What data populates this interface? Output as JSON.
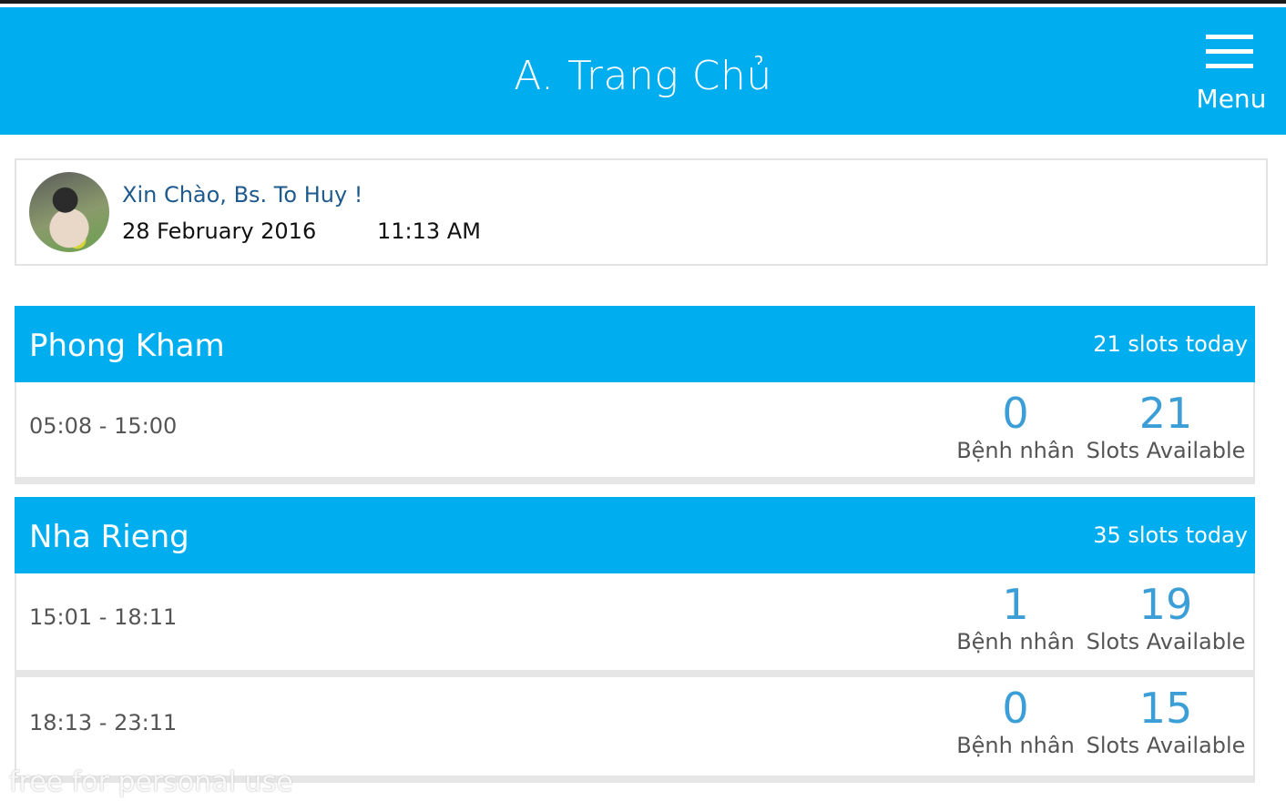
{
  "header": {
    "title": "A. Trang Chủ",
    "menu_label": "Menu"
  },
  "greeting": {
    "name": "Xin Chào, Bs. To Huy !",
    "date": "28 February 2016",
    "time": "11:13 AM"
  },
  "clinics": [
    {
      "name": "Phong Kham",
      "slots_today": "21 slots today",
      "sessions": [
        {
          "time": "05:08 - 15:00",
          "patients": "0",
          "patients_label": "Bệnh nhân",
          "available": "21",
          "available_label": "Slots Available"
        }
      ]
    },
    {
      "name": "Nha Rieng",
      "slots_today": "35 slots today",
      "sessions": [
        {
          "time": "15:01 - 18:11",
          "patients": "1",
          "patients_label": "Bệnh nhân",
          "available": "19",
          "available_label": "Slots Available"
        },
        {
          "time": "18:13 - 23:11",
          "patients": "0",
          "patients_label": "Bệnh nhân",
          "available": "15",
          "available_label": "Slots Available"
        }
      ]
    }
  ],
  "watermark": "free for personal use",
  "colors": {
    "primary": "#00adee",
    "stat_number": "#3b9ed6",
    "greeting_name": "#1e5a8e"
  }
}
